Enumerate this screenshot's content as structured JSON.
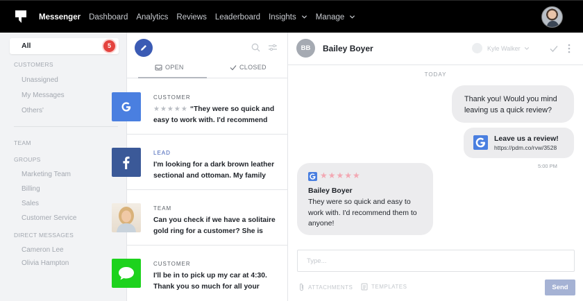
{
  "topnav": {
    "items": [
      {
        "label": "Messenger",
        "active": true,
        "dropdown": false
      },
      {
        "label": "Dashboard",
        "active": false,
        "dropdown": false
      },
      {
        "label": "Analytics",
        "active": false,
        "dropdown": false
      },
      {
        "label": "Reviews",
        "active": false,
        "dropdown": false
      },
      {
        "label": "Leaderboard",
        "active": false,
        "dropdown": false
      },
      {
        "label": "Insights",
        "active": false,
        "dropdown": true
      },
      {
        "label": "Manage",
        "active": false,
        "dropdown": true
      }
    ]
  },
  "sidebar": {
    "all_label": "All",
    "all_badge": "5",
    "customers_heading": "CUSTOMERS",
    "customer_items": [
      "Unassigned",
      "My Messages",
      "Others'"
    ],
    "team_heading": "TEAM",
    "groups_heading": "GROUPS",
    "group_items": [
      "Marketing Team",
      "Billing",
      "Sales",
      "Customer Service"
    ],
    "dm_heading": "DIRECT MESSAGES",
    "dm_items": [
      "Cameron Lee",
      "Olivia Hampton"
    ]
  },
  "list": {
    "tabs": {
      "open": "OPEN",
      "closed": "CLOSED"
    },
    "conversations": [
      {
        "channel": "google",
        "tag": "CUSTOMER",
        "stars": "★★★★★",
        "text": "“They were so quick and easy to work with. I'd recommend th..."
      },
      {
        "channel": "facebook",
        "tag": "LEAD",
        "text": "I'm looking for a dark brown leather sectional and ottoman. My family w..."
      },
      {
        "channel": "team",
        "tag": "TEAM",
        "text": "Can you check if we have a solitaire gold ring for a customer? She is ho..."
      },
      {
        "channel": "sms",
        "tag": "CUSTOMER",
        "text": "I'll be in to pick up my car at 4:30. Thank you so much for all your help!"
      }
    ]
  },
  "chat": {
    "contact_initials": "BB",
    "contact_name": "Bailey Boyer",
    "assignee": "Kyle Walker",
    "day_label": "TODAY",
    "outgoing_text": "Thank you! Would you mind leaving us a quick review?",
    "review_link_title": "Leave us a review!",
    "review_link_url": "https://pdm.co/rvw/3528",
    "outgoing_time": "5:00 PM",
    "incoming_stars": "★★★★★",
    "incoming_name": "Bailey Boyer",
    "incoming_text": "They were so quick and easy to work with. I'd recommend them to anyone!",
    "composer_placeholder": "Type...",
    "attachments_label": "ATTACHMENTS",
    "templates_label": "TEMPLATES",
    "send_label": "Send"
  },
  "colors": {
    "google": "#4a7fe0",
    "facebook": "#3b5998",
    "sms": "#1dd21d",
    "badge": "#e4433e",
    "accent": "#3b5bb4"
  }
}
